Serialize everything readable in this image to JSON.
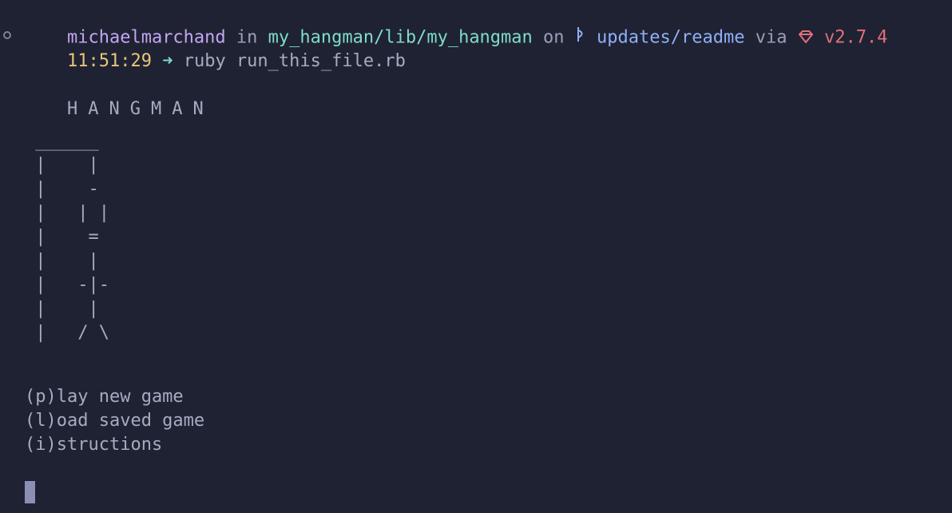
{
  "prompt": {
    "user": "michaelmarchand",
    "in_word": " in ",
    "path": "my_hangman/lib/my_hangman",
    "on_word": " on ",
    "branch": "updates/readme",
    "via_word": " via ",
    "ruby_version": "v2.7.4",
    "time": "11:51:29",
    "command": "ruby run_this_file.rb"
  },
  "game": {
    "title": "HANGMAN",
    "gallows": " ______\n |    |\n |    -\n |   | |\n |    =\n |    |\n |   -|-\n |    |\n |   / \\"
  },
  "menu": [
    "(p)lay new game",
    "(l)oad saved game",
    "(i)structions"
  ],
  "colors": {
    "background": "#1f2233",
    "user": "#c3a6f0",
    "path": "#7fdcc8",
    "branch": "#8fb0f5",
    "ruby": "#e0707a",
    "time": "#e8c679"
  }
}
